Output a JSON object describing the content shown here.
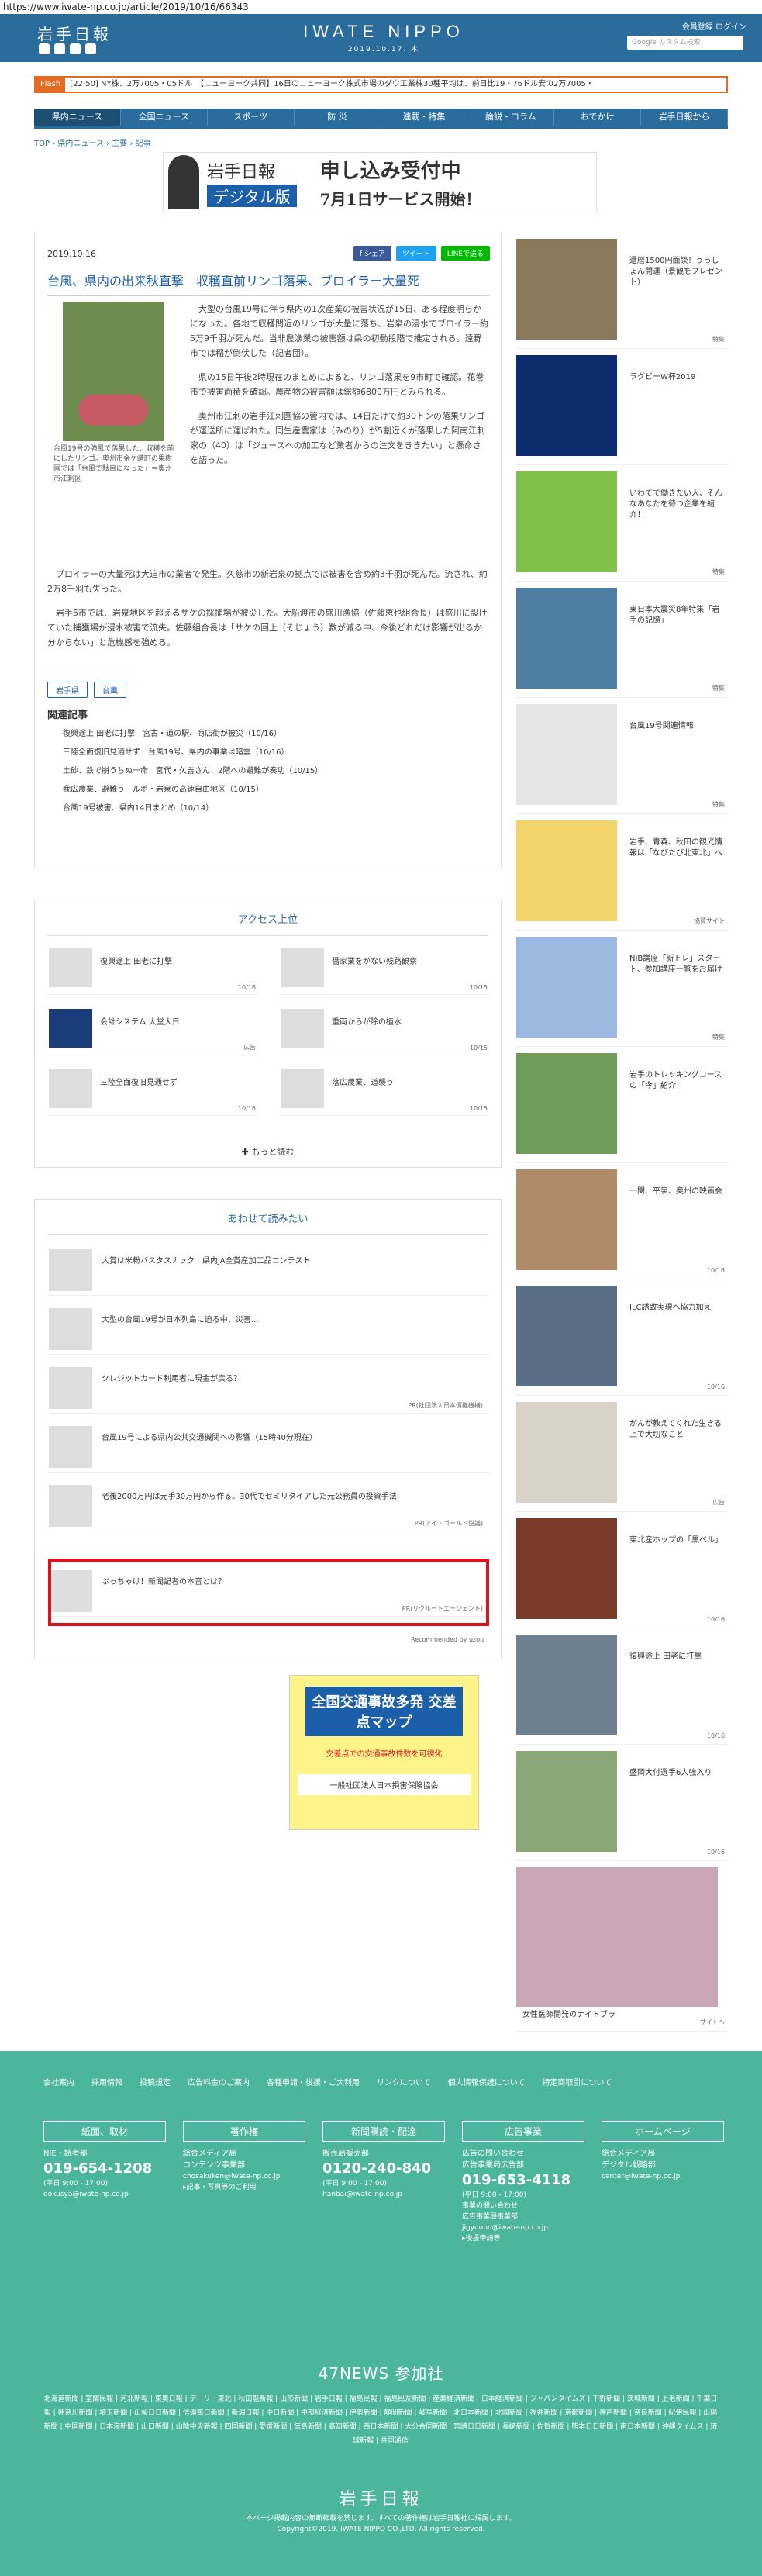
{
  "browser": {
    "url": "https://www.iwate-np.co.jp/article/2019/10/16/66343"
  },
  "header": {
    "logo": "岩手日報",
    "brand": "IWATE NIPPO",
    "date": "2019.10.17. 木",
    "account": "会員登録  ログイン",
    "links": "Webアルバム ▸  記事データベース ▸  広告料金 ▸",
    "search_placeholder": "Google カスタム検索"
  },
  "flash": {
    "tag": "Flash",
    "text": "[22:50] NY株、2万7005・05ドル　【ニューヨーク共同】16日のニューヨーク株式市場のダウ工業株30種平均は、前日比19・76ドル安の2万7005・"
  },
  "nav": [
    "県内ニュース",
    "全国ニュース",
    "スポーツ",
    "防 災",
    "連載・特集",
    "論説・コラム",
    "おでかけ",
    "岩手日報から"
  ],
  "breadcrumb": "TOP › 県内ニュース › 主要 › 記事",
  "banner": {
    "t1": "岩手日報",
    "t2": "デジタル版",
    "r1": "申し込み受付中",
    "r2": "7月1日サービス開始！"
  },
  "article": {
    "date": "2019.10.16",
    "share": [
      "f シェア",
      "ツイート",
      "LINEで送る"
    ],
    "title": "台風、県内の出来秋直撃　収穫直前リンゴ落果、ブロイラー大量死",
    "caption": "台風19号の強風で落果した、収穫を前にしたリンゴ。奥州市金ケ崎町の果樹園では「台風で駄目になった」＝奥州市江刺区",
    "p1": "大型の台風19号に伴う県内の1次産業の被害状況が15日、ある程度明らかになった。各地で収穫間近のリンゴが大量に落ち、岩泉の浸水でブロイラー約5万9千羽が死んだ。当非農漁業の被害額は県の初動段階で推定される。遠野市では稲が倒伏した（記者団）。",
    "p2": "県の15日午後2時現在のまとめによると、リンゴ落果を9市町で確認。花巻市で被害面積を確認。農産物の被害額は総額6800万円とみられる。",
    "p3": "奥州市江刺の岩手江刺園協の管内では、14日だけで約30トンの落果リンゴが運送所に運ばれた。同生産農家は（みのり）が5割近くが落果した阿南江刺家の（40）は「ジュースへの加工など業者からの注文をききたい」と懸命さを語った。",
    "p4": "ブロイラーの大量死は大迫市の業者で発生。久慈市の新岩泉の拠点では被害を含め約3千羽が死んだ。流され、約2万8千羽も失った。",
    "p5": "岩手5市では、岩泉地区を超えるサケの採捕場が被災した。大船渡市の盛川漁協（佐藤恵也組合長）は盛川に設けていた捕獲場が浸水被害で流失。佐藤組合長は「サケの回上（そじょう）数が減る中、今後どれだけ影響が出るか分からない」と危機感を強める。",
    "tags": [
      "岩手県",
      "台風"
    ],
    "related_heading": "関連記事",
    "related": [
      "復興途上 田老に打撃　宮古・道の駅、商店街が被災（10/16）",
      "三陸全面復旧見通せず　台風19号、県内の事業は暗雲（10/16）",
      "土砂、鉄で崩うちぬ一命　宮代・久吉さん、2階への避難が奏功（10/15）",
      "我広農業、避難う　ルポ・岩泉の高速自由地区（10/15）",
      "台風19号被害、県内14日まとめ（10/14）"
    ]
  },
  "ranking": {
    "heading": "アクセス上位",
    "items": [
      {
        "t": "復興途上 田老に打撃",
        "d": "10/16"
      },
      {
        "t": "醤家業をかない残路観察",
        "d": "10/15"
      },
      {
        "t": "会計システム 大堂大日",
        "d": "広告"
      },
      {
        "t": "重両からが除の植水",
        "d": "10/15"
      },
      {
        "t": "三陸全面復旧見通せず",
        "d": "10/16"
      },
      {
        "t": "落広農業、道襲う",
        "d": "10/15"
      }
    ],
    "more": "もっと読む"
  },
  "recommend": {
    "heading": "あわせて読みたい",
    "items": [
      {
        "t": "大賞は米粉バスタスナック　県内JA全賞産加工品コンテスト",
        "pr": ""
      },
      {
        "t": "大型の台風19号が日本列島に迫る中、災害…",
        "pr": ""
      },
      {
        "t": "クレジットカード利用者に現金が戻る？",
        "pr": "PR(社団法人日本債権機構)"
      },
      {
        "t": "台風19号による県内公共交通機関への影響（15時40分現在）",
        "pr": ""
      },
      {
        "t": "老後2000万円は元手30万円から作る。30代でセミリタイアした元公務員の投資手法",
        "pr": "PR(アイ・ゴールド協議)"
      },
      {
        "t": "ぶっちゃけ！新聞記者の本音とは？",
        "pr": "PR(リクルートエージェント)"
      }
    ],
    "powered": "Recommended by uzou"
  },
  "sidead": {
    "a1": "全国交通事故多発\n交差点マップ",
    "a2": "交差点での交通事故件数を可視化",
    "a3": "一般社団法人日本損害保険協会"
  },
  "side": [
    {
      "t": "還暦1500円面談！うっしょん開運（景観をプレゼント）",
      "l": "特集"
    },
    {
      "t": "ラグビーW杯2019",
      "l": ""
    },
    {
      "t": "いわてで働きたい人、そんなあなたを待つ企業を紹介！",
      "l": "特集"
    },
    {
      "t": "東日本大震災8年特集「岩手の記憶」",
      "l": "特集"
    },
    {
      "t": "台風19号関連情報",
      "l": "特集"
    },
    {
      "t": "岩手、青森、秋田の観光情報は「なびたび北東北」へ",
      "l": "協賛サイト"
    },
    {
      "t": "NIB講座「新トレ」スタート、参加講座一覧をお届け",
      "l": "特集"
    },
    {
      "t": "岩手のトレッキングコースの「今」紹介！",
      "l": ""
    },
    {
      "t": "一関、平泉、奥州の映画会",
      "l": "10/16"
    },
    {
      "t": "ILC誘致実現へ協力加え",
      "l": "10/16"
    },
    {
      "t": "がんが教えてくれた生きる上で大切なこと",
      "l": "広告"
    },
    {
      "t": "東北産ホップの「黒ベル」",
      "l": "10/16"
    },
    {
      "t": "復興途上 田老に打撃",
      "l": "10/16"
    },
    {
      "t": "盛岡大付選手6人強入り",
      "l": "10/16"
    },
    {
      "t": "女性医師開発のナイトブラ",
      "l": "サイトへ"
    }
  ],
  "footer": {
    "links": [
      "会社案内",
      "採用情報",
      "投稿規定",
      "広告料金のご案内",
      "各種申請・後援・ご大利用",
      "リンクについて",
      "個人情報保護について",
      "特定商取引について"
    ],
    "cols": [
      {
        "h": "紙面、取材",
        "l": "NIE・読者部",
        "n": "019-654-1208",
        "m": "(平日 9:00 - 17:00)\ndokusya@iwate-np.co.jp"
      },
      {
        "h": "著作権",
        "l": "総合メディア局\nコンテンツ事業部",
        "n": "",
        "m": "chosakuken@iwate-np.co.jp\n▸記事・写真等のご利用"
      },
      {
        "h": "新聞購読・配達",
        "l": "販売局販売部",
        "n": "0120-240-840",
        "m": "(平日 9:00 - 17:00)\nhanbai@iwate-np.co.jp"
      },
      {
        "h": "広告事業",
        "l": "広告の問い合わせ\n広告事業局広告部",
        "n": "019-653-4118",
        "m": "(平日 9:00 - 17:00)\n事業の問い合わせ\n広告事業局事業部\njigyoubu@iwate-np.co.jp\n▸後援申請等"
      },
      {
        "h": "ホームページ",
        "l": "総合メディア局\nデジタル戦略部",
        "n": "",
        "m": "center@iwate-np.co.jp"
      }
    ],
    "news47": "47NEWS 参加社",
    "members": "北海道新聞 | 室蘭民報 | 河北新報 | 東奥日報 | デーリー東北 | 秋田魁新報 | 山形新聞 | 岩手日報 | 福島民報 | 福島民友新聞 | 産業経済新聞 | 日本経済新聞 | ジャパンタイムズ | 下野新聞 | 茨城新聞 | 上毛新聞 | 千葉日報 | 神奈川新聞 | 埼玉新聞 | 山梨日日新聞 | 信濃毎日新聞 | 新潟日報 | 中日新聞 | 中部経済新聞 | 伊勢新聞 | 静岡新聞 | 岐阜新聞 | 北日本新聞 | 北國新聞 | 福井新聞 | 京都新聞 | 神戸新聞 | 奈良新聞 | 紀伊民報 | 山陽新聞 | 中国新聞 | 日本海新聞 | 山口新聞 | 山陰中央新報 | 四国新聞 | 愛媛新聞 | 徳島新聞 | 高知新聞 | 西日本新聞 | 大分合同新聞 | 宮崎日日新聞 | 長崎新聞 | 佐賀新聞 | 熊本日日新聞 | 南日本新聞 | 沖縄タイムス | 琉球新報 | 共同通信",
    "logo": "岩手日報",
    "copy": "本ページ掲載内容の無断転載を禁じます。すべての著作権は岩手日報社に帰属します。\nCopyright©2019. IWATE NIPPO CO.,LTD. All rights reserved."
  }
}
